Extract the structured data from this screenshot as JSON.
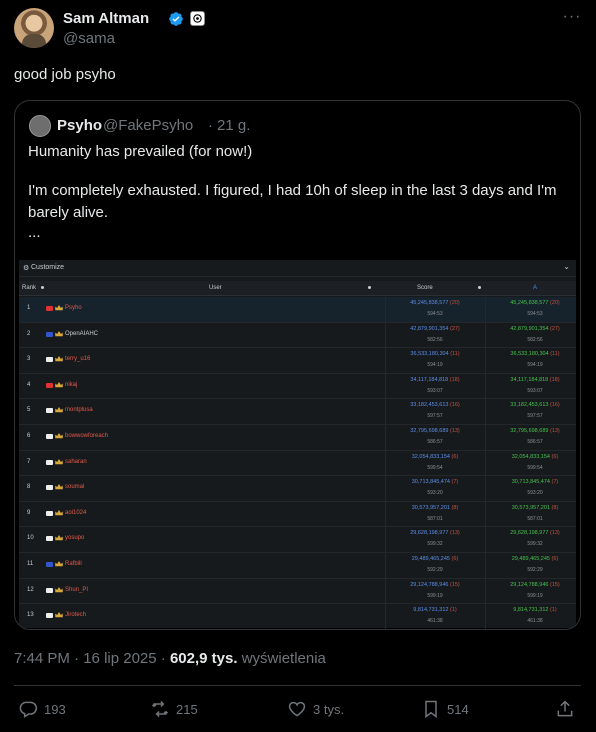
{
  "author": {
    "name": "Sam Altman",
    "handle": "@sama"
  },
  "tweet": {
    "text": "good job psyho"
  },
  "quote": {
    "name": "Psyho",
    "handle": "@FakePsyho",
    "dot": "·",
    "time": "21 g.",
    "line1": "Humanity has prevailed (for now!)",
    "line2": "I'm completely exhausted. I figured, I had 10h of sleep in the last 3 days and I'm",
    "line3": "barely alive.",
    "line4": "..."
  },
  "leaderboard": {
    "customize": "Customize",
    "chevron": "⌄",
    "headers": {
      "rank": "Rank",
      "user": "User",
      "score": "Score",
      "a": "A"
    },
    "rows": [
      {
        "rank": "1",
        "user": "Psyho",
        "score": "45,245,838,577",
        "srank": "(20)",
        "time": "594:53",
        "flag": "#e03030"
      },
      {
        "rank": "2",
        "user": "OpenAIAHC",
        "score": "42,879,901,354",
        "srank": "(27)",
        "time": "582:56",
        "flag": "#3355cc"
      },
      {
        "rank": "3",
        "user": "terry_u16",
        "score": "36,533,180,304",
        "srank": "(11)",
        "time": "594:19",
        "flag": "#eeeeee"
      },
      {
        "rank": "4",
        "user": "nikaj",
        "score": "34,117,184,818",
        "srank": "(18)",
        "time": "593:07",
        "flag": "#e03030"
      },
      {
        "rank": "5",
        "user": "montplusa",
        "score": "33,182,453,613",
        "srank": "(16)",
        "time": "597:57",
        "flag": "#eeeeee"
      },
      {
        "rank": "6",
        "user": "bowwowforeach",
        "score": "32,795,698,689",
        "srank": "(13)",
        "time": "586:57",
        "flag": "#eeeeee"
      },
      {
        "rank": "7",
        "user": "saharan",
        "score": "32,054,833,154",
        "srank": "(6)",
        "time": "599:54",
        "flag": "#eeeeee"
      },
      {
        "rank": "8",
        "user": "soumal",
        "score": "30,713,845,474",
        "srank": "(7)",
        "time": "593:20",
        "flag": "#eeeeee"
      },
      {
        "rank": "9",
        "user": "aoi1024",
        "score": "30,573,957,201",
        "srank": "(8)",
        "time": "587:01",
        "flag": "#eeeeee"
      },
      {
        "rank": "10",
        "user": "yosupo",
        "score": "29,628,198,977",
        "srank": "(13)",
        "time": "599:32",
        "flag": "#eeeeee"
      },
      {
        "rank": "11",
        "user": "Rafbill",
        "score": "29,489,465,245",
        "srank": "(6)",
        "time": "592:29",
        "flag": "#3355cc"
      },
      {
        "rank": "12",
        "user": "Shun_PI",
        "score": "29,124,788,946",
        "srank": "(15)",
        "time": "599:19",
        "flag": "#eeeeee"
      },
      {
        "rank": "13",
        "user": "Jirotech",
        "score": "9,814,731,312",
        "srank": "(1)",
        "time": "461:38",
        "flag": "#eeeeee"
      }
    ]
  },
  "meta": {
    "time": "7:44 PM",
    "sep": "·",
    "date": "16 lip 2025",
    "views": "602,9 tys.",
    "views_label": "wyświetlenia"
  },
  "actions": {
    "replies": "193",
    "retweets": "215",
    "likes": "3 tys.",
    "bookmarks": "514"
  },
  "colors": {
    "background": "#000000",
    "text": "#e7e9ea",
    "muted": "#71767b",
    "verified": "#1d9bf0",
    "border": "#2f3336"
  },
  "icons": [
    "verified-icon",
    "org-badge-icon",
    "more-icon",
    "reply-icon",
    "retweet-icon",
    "like-icon",
    "bookmark-icon",
    "share-icon",
    "settings-icon",
    "crown-icon"
  ]
}
